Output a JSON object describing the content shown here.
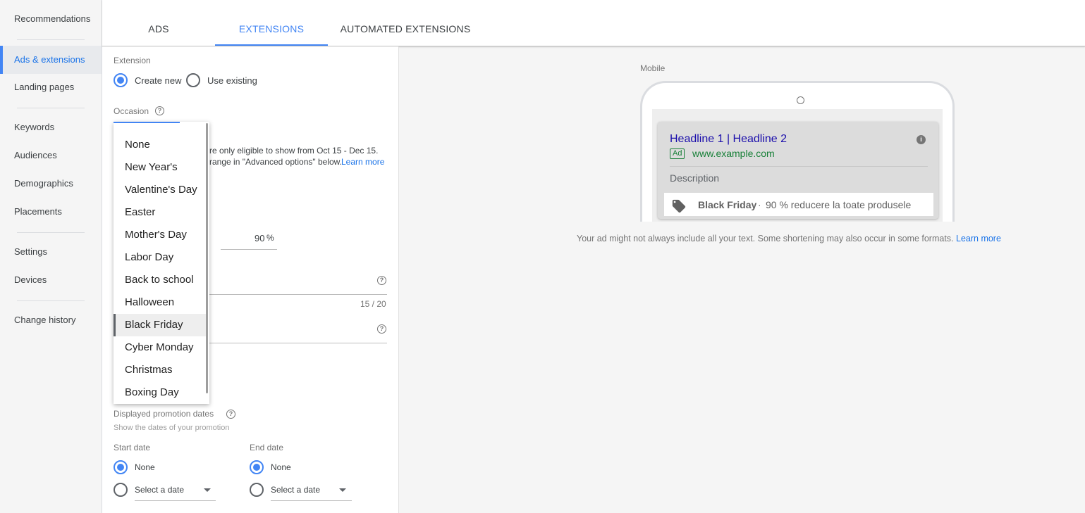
{
  "sidebar": {
    "items": [
      {
        "label": "Recommendations"
      },
      {
        "label": "Ads & extensions"
      },
      {
        "label": "Landing pages"
      },
      {
        "label": "Keywords"
      },
      {
        "label": "Audiences"
      },
      {
        "label": "Demographics"
      },
      {
        "label": "Placements"
      },
      {
        "label": "Settings"
      },
      {
        "label": "Devices"
      },
      {
        "label": "Change history"
      }
    ]
  },
  "tabs": [
    {
      "label": "ADS"
    },
    {
      "label": "EXTENSIONS"
    },
    {
      "label": "AUTOMATED EXTENSIONS"
    }
  ],
  "form": {
    "extension_label": "Extension",
    "create_new": "Create new",
    "use_existing": "Use existing",
    "occasion_label": "Occasion",
    "occasion_note_1": "re only eligible to show from Oct 15 - Dec 15.",
    "occasion_note_2": "range in \"Advanced options\" below.",
    "learn_more": "Learn more",
    "percent_value": "90",
    "percent_unit": "%",
    "char_count": "15 / 20",
    "displayed_dates_label": "Displayed promotion dates",
    "displayed_dates_hint": "Show the dates of your promotion",
    "start_date_label": "Start date",
    "end_date_label": "End date",
    "none_label": "None",
    "select_date": "Select a date"
  },
  "dropdown": {
    "options": [
      "None",
      "New Year's",
      "Valentine's Day",
      "Easter",
      "Mother's Day",
      "Labor Day",
      "Back to school",
      "Halloween",
      "Black Friday",
      "Cyber Monday",
      "Christmas",
      "Boxing Day"
    ],
    "selected": "Black Friday"
  },
  "preview": {
    "label": "Mobile",
    "headline": "Headline 1 | Headline 2",
    "badge": "Ad",
    "url": "www.example.com",
    "description": "Description",
    "promo_occasion": "Black Friday",
    "promo_separator": "·",
    "promo_text": "90 % reducere la toate produsele",
    "note": "Your ad might not always include all your text. Some shortening may also occur in some formats.",
    "note_link": "Learn more"
  },
  "colors": {
    "accent": "#4285f4",
    "link": "#1a73e8",
    "ad_green": "#188038",
    "headline": "#1a0dab"
  }
}
